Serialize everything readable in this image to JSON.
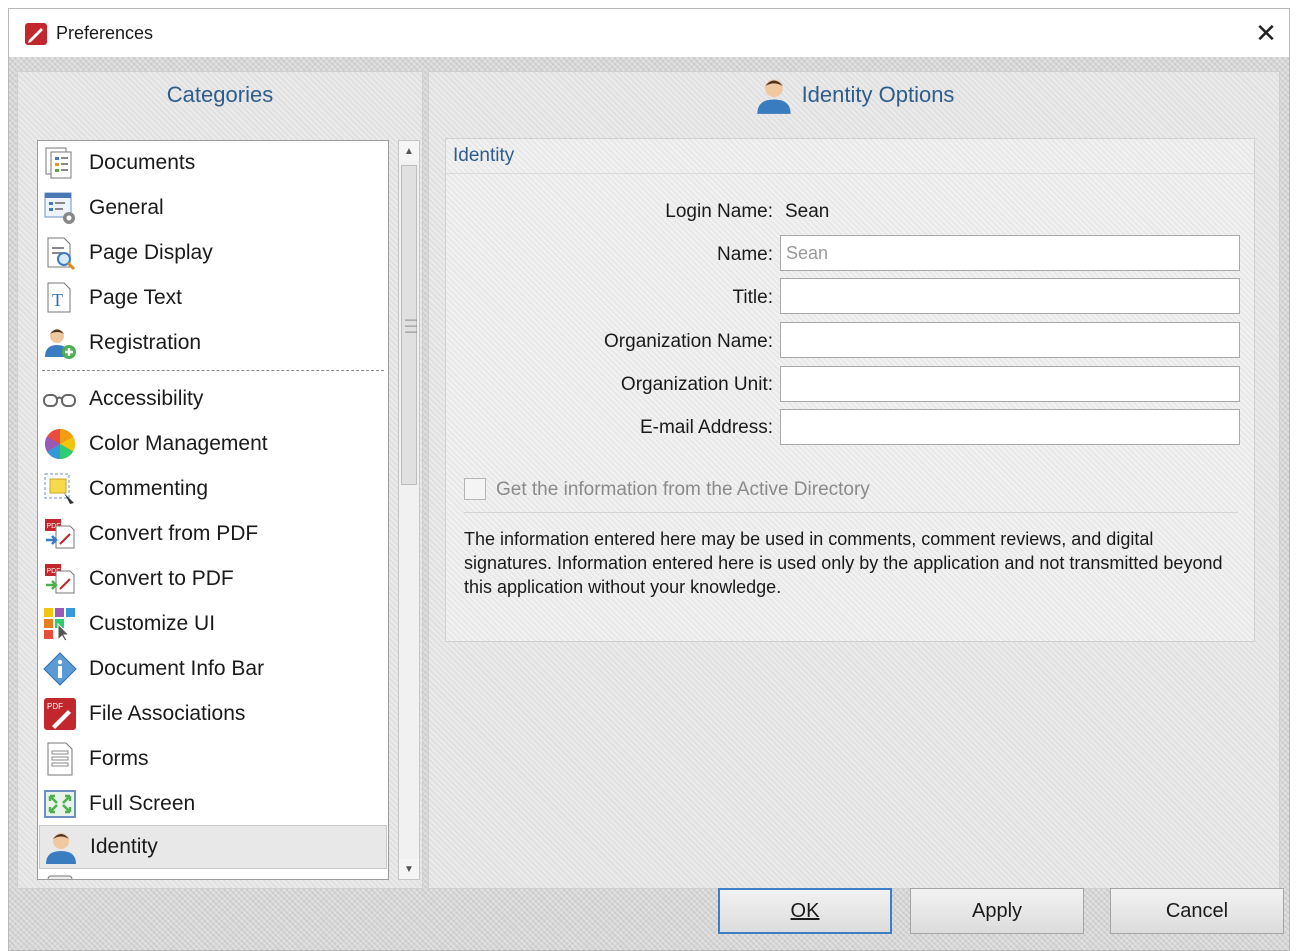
{
  "window": {
    "title": "Preferences",
    "close_glyph": "✕"
  },
  "left_panel": {
    "heading": "Categories",
    "items": [
      {
        "label": "Documents",
        "icon": "documents-icon"
      },
      {
        "label": "General",
        "icon": "general-settings-icon"
      },
      {
        "label": "Page Display",
        "icon": "page-display-icon"
      },
      {
        "label": "Page Text",
        "icon": "page-text-icon"
      },
      {
        "label": "Registration",
        "icon": "registration-icon"
      },
      {
        "label": "Accessibility",
        "icon": "glasses-icon"
      },
      {
        "label": "Color Management",
        "icon": "color-wheel-icon"
      },
      {
        "label": "Commenting",
        "icon": "commenting-icon"
      },
      {
        "label": "Convert from PDF",
        "icon": "convert-from-pdf-icon"
      },
      {
        "label": "Convert to PDF",
        "icon": "convert-to-pdf-icon"
      },
      {
        "label": "Customize UI",
        "icon": "customize-ui-icon"
      },
      {
        "label": "Document Info Bar",
        "icon": "info-icon"
      },
      {
        "label": "File Associations",
        "icon": "pdf-file-icon"
      },
      {
        "label": "Forms",
        "icon": "forms-icon"
      },
      {
        "label": "Full Screen",
        "icon": "full-screen-icon"
      },
      {
        "label": "Identity",
        "icon": "user-icon"
      }
    ],
    "selected": "Identity"
  },
  "right_panel": {
    "heading": "Identity Options",
    "group_title": "Identity",
    "fields": {
      "login_name_label": "Login Name:",
      "login_name_value": "Sean",
      "name_label": "Name:",
      "name_placeholder": "Sean",
      "title_label": "Title:",
      "org_name_label": "Organization Name:",
      "org_unit_label": "Organization Unit:",
      "email_label": "E-mail Address:"
    },
    "active_directory_label": "Get the information from the Active Directory",
    "info_text": "The information entered here may be used in comments, comment reviews, and digital signatures. Information entered here is used only by the application and not transmitted beyond this application without your knowledge."
  },
  "buttons": {
    "ok": "OK",
    "apply": "Apply",
    "cancel": "Cancel"
  },
  "colors": {
    "accent": "#2e5d8c",
    "default_button_border": "#3c7fc4"
  }
}
